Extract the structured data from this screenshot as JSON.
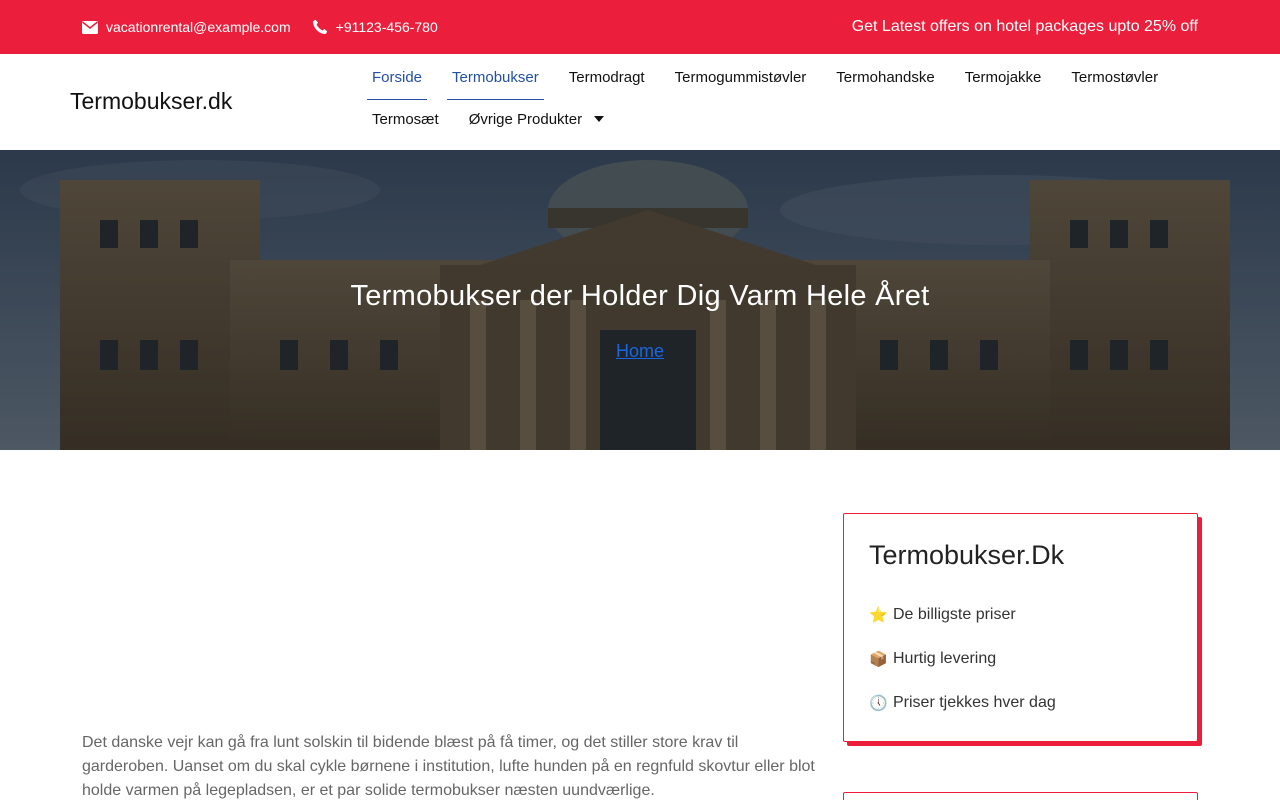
{
  "topbar": {
    "email": "vacationrental@example.com",
    "phone": "+91123-456-780",
    "offer": "Get Latest offers on hotel packages upto 25% off",
    "email_icon": "envelope-icon",
    "phone_icon": "phone-icon"
  },
  "header": {
    "brand": "Termobukser.dk",
    "nav": [
      {
        "label": "Forside",
        "active": true
      },
      {
        "label": "Termobukser",
        "active": true
      },
      {
        "label": "Termodragt"
      },
      {
        "label": "Termogummistøvler"
      },
      {
        "label": "Termohandske"
      },
      {
        "label": "Termojakke"
      },
      {
        "label": "Termostøvler"
      },
      {
        "label": "Termosæt"
      },
      {
        "label": "Øvrige Produkter",
        "dropdown": true
      }
    ]
  },
  "hero": {
    "title": "Termobukser der Holder Dig Varm Hele Året",
    "breadcrumb": "Home"
  },
  "article": {
    "intro": "Det danske vejr kan gå fra lunt solskin til bidende blæst på få timer, og det stiller store krav til garderoben. Uanset om du skal cykle børnene i institution, lufte hunden på en regnfuld skovtur eller blot holde varmen på legepladsen, er et par solide termobukser næsten uundværlige."
  },
  "sidebar": {
    "heading": "Termobukser.Dk",
    "items": [
      {
        "emoji": "⭐",
        "label": "De billigste priser"
      },
      {
        "emoji": "📦",
        "label": "Hurtig levering"
      },
      {
        "emoji": "🕔",
        "label": "Priser tjekkes hver dag"
      }
    ]
  },
  "colors": {
    "accent": "#eb1f3b",
    "nav_active": "#2350a6",
    "link": "#1a66e0"
  }
}
